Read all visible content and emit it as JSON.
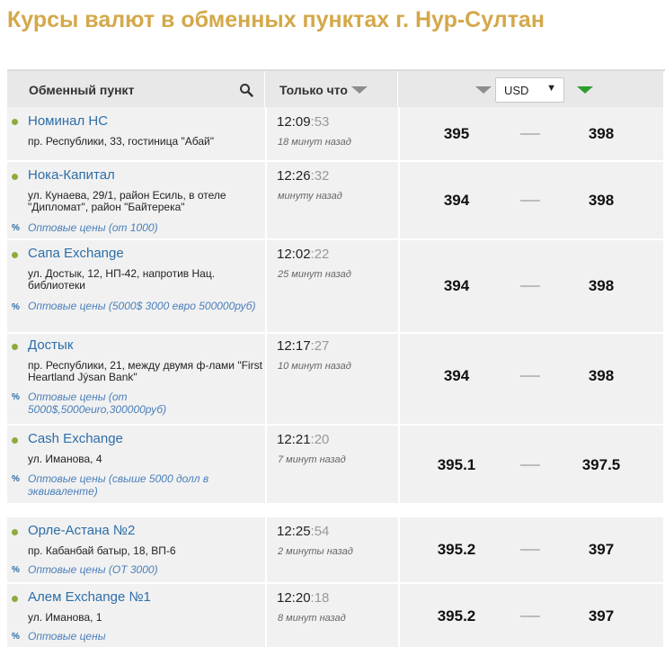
{
  "page": {
    "title": "Курсы валют в обменных пунктах г. Нур-Султан"
  },
  "header": {
    "point_label": "Обменный пункт",
    "time_label": "Только что",
    "currency_selected": "USD",
    "currency_caret": "▼",
    "icons": [
      "search-icon",
      "sort-down-icon",
      "sort-down-green-icon"
    ],
    "colors": {
      "title": "#d4a84a",
      "link": "#2d6ea8",
      "dot": "#8eab3d",
      "sell_arrow": "#2f9e2f"
    }
  },
  "rows": [
    {
      "name": "Номинал НС",
      "address": "пр. Республики, 33, гостиница \"Абай\"",
      "wholesale": "",
      "time": "12:09",
      "seconds": ":53",
      "ago": "18 минут назад",
      "buy": "395",
      "sell": "398"
    },
    {
      "name": "Нока-Капитал",
      "address": "ул. Кунаева, 29/1, район Есиль, в отеле \"Дипломат\", район \"Байтерека\"",
      "wholesale": "Оптовые цены (от 1000)",
      "time": "12:26",
      "seconds": ":32",
      "ago": "минуту назад",
      "buy": "394",
      "sell": "398"
    },
    {
      "name": "Сапа Exchange",
      "address": "ул. Достык, 12, НП-42, напротив Нац. библиотеки",
      "wholesale": "Оптовые цены (5000$ 3000 евро 500000руб)",
      "time": "12:02",
      "seconds": ":22",
      "ago": "25 минут назад",
      "buy": "394",
      "sell": "398"
    },
    {
      "name": "Достык",
      "address": "пр. Республики, 21, между двумя ф-лами \"First Heartland Jýsan Bank\"",
      "wholesale": "Оптовые цены (от 5000$,5000euro,300000руб)",
      "time": "12:17",
      "seconds": ":27",
      "ago": "10 минут назад",
      "buy": "394",
      "sell": "398"
    },
    {
      "name": "Cash Exchange",
      "address": "ул. Иманова, 4",
      "wholesale": "Оптовые цены (свыше 5000 долл в эквиваленте)",
      "time": "12:21",
      "seconds": ":20",
      "ago": "7 минут назад",
      "buy": "395.1",
      "sell": "397.5"
    },
    {
      "name": "Орле-Астана №2",
      "address": "пр. Кабанбай батыр, 18, ВП-6",
      "wholesale": "Оптовые цены (ОТ 3000)",
      "time": "12:25",
      "seconds": ":54",
      "ago": "2 минуты назад",
      "buy": "395.2",
      "sell": "397"
    },
    {
      "name": "Алем Exchange №1",
      "address": "ул. Иманова, 1",
      "wholesale": "Оптовые цены",
      "time": "12:20",
      "seconds": ":18",
      "ago": "8 минут назад",
      "buy": "395.2",
      "sell": "397"
    }
  ]
}
